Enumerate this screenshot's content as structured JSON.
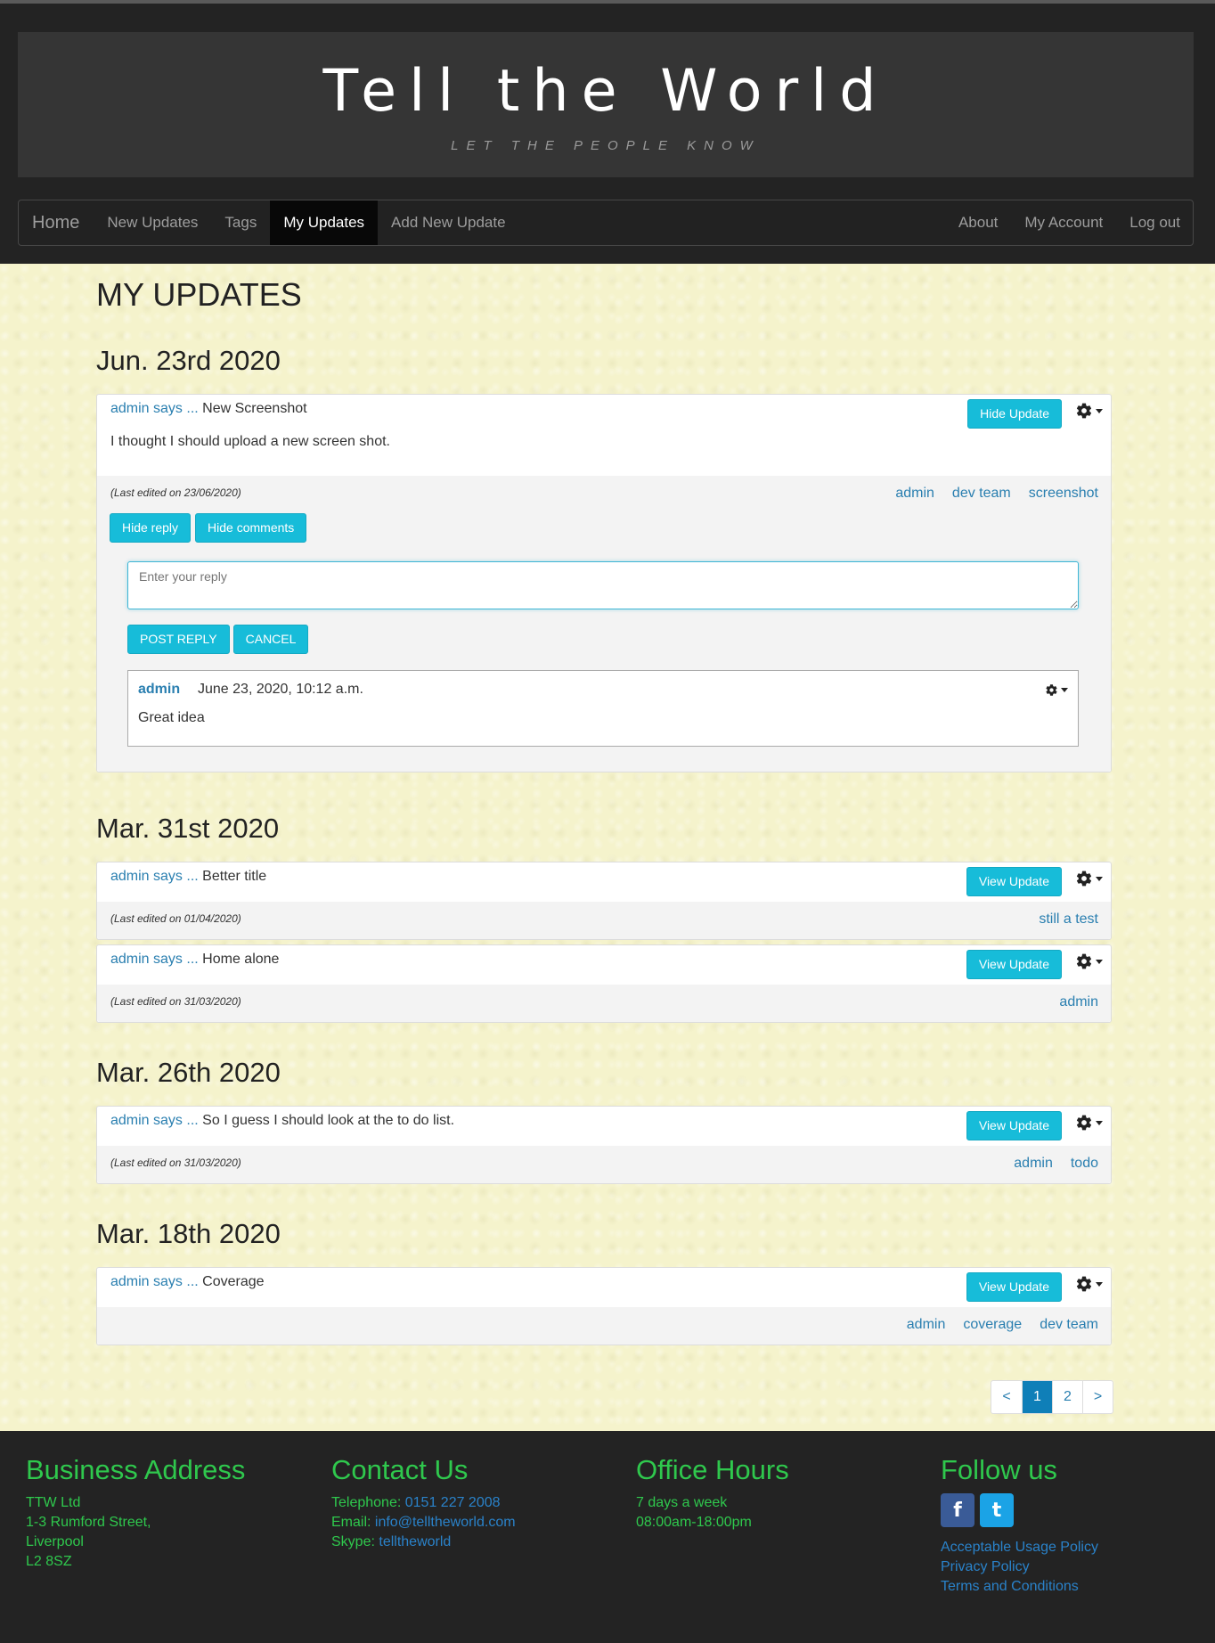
{
  "site": {
    "title": "Tell the World",
    "tagline": "LET THE PEOPLE KNOW"
  },
  "nav": {
    "brand": "Home",
    "left": [
      "New Updates",
      "Tags",
      "My Updates",
      "Add New Update"
    ],
    "right": [
      "About",
      "My Account",
      "Log out"
    ],
    "active": "My Updates"
  },
  "page_title": "MY UPDATES",
  "groups": [
    {
      "date": "Jun. 23rd 2020",
      "updates": [
        {
          "author": "admin says",
          "sep": "...",
          "title": "New Screenshot",
          "body": "I thought I should upload a new screen shot.",
          "button": "Hide Update",
          "edited": "(Last edited on 23/06/2020)",
          "tags": [
            "admin",
            "dev team",
            "screenshot"
          ],
          "actions": [
            "Hide reply",
            "Hide comments"
          ],
          "reply_placeholder": "Enter your reply",
          "reply_buttons": [
            "POST REPLY",
            "CANCEL"
          ],
          "comment": {
            "author": "admin",
            "time": "June 23, 2020, 10:12 a.m.",
            "text": "Great idea"
          }
        }
      ]
    },
    {
      "date": "Mar. 31st 2020",
      "updates": [
        {
          "author": "admin says",
          "sep": "...",
          "title": "Better title",
          "button": "View Update",
          "edited": "(Last edited on 01/04/2020)",
          "tags": [
            "still a test"
          ]
        },
        {
          "author": "admin says",
          "sep": "...",
          "title": "Home alone",
          "button": "View Update",
          "edited": "(Last edited on 31/03/2020)",
          "tags": [
            "admin"
          ]
        }
      ]
    },
    {
      "date": "Mar. 26th 2020",
      "updates": [
        {
          "author": "admin says",
          "sep": "...",
          "title": "So I guess I should look at the to do list.",
          "button": "View Update",
          "edited": "(Last edited on 31/03/2020)",
          "tags": [
            "admin",
            "todo"
          ]
        }
      ]
    },
    {
      "date": "Mar. 18th 2020",
      "updates": [
        {
          "author": "admin says",
          "sep": "...",
          "title": "Coverage",
          "button": "View Update",
          "edited": "",
          "tags": [
            "admin",
            "coverage",
            "dev team"
          ]
        }
      ]
    }
  ],
  "pagination": {
    "prev": "<",
    "pages": [
      "1",
      "2"
    ],
    "next": ">",
    "current": "1"
  },
  "footer": {
    "business": {
      "heading": "Business Address",
      "lines": [
        "TTW Ltd",
        "1-3 Rumford Street,",
        "Liverpool",
        "L2 8SZ"
      ]
    },
    "contact": {
      "heading": "Contact Us",
      "telephone_label": "Telephone:",
      "telephone": "0151 227 2008",
      "email_label": "Email:",
      "email": "info@telltheworld.com",
      "skype_label": "Skype:",
      "skype": "telltheworld"
    },
    "hours": {
      "heading": "Office Hours",
      "lines": [
        "7 days a week",
        "08:00am-18:00pm"
      ]
    },
    "follow": {
      "heading": "Follow us",
      "facebook": "f",
      "twitter": "t",
      "links": [
        "Acceptable Usage Policy",
        "Privacy Policy",
        "Terms and Conditions"
      ]
    }
  },
  "colors": {
    "accent_button": "#17bcd9",
    "link": "#2a7fb0",
    "footer_heading": "#2fc84d",
    "page_bg": "#f5f3cc"
  },
  "icons": {
    "settings": "gear-icon",
    "dropdown": "caret-down-icon"
  }
}
